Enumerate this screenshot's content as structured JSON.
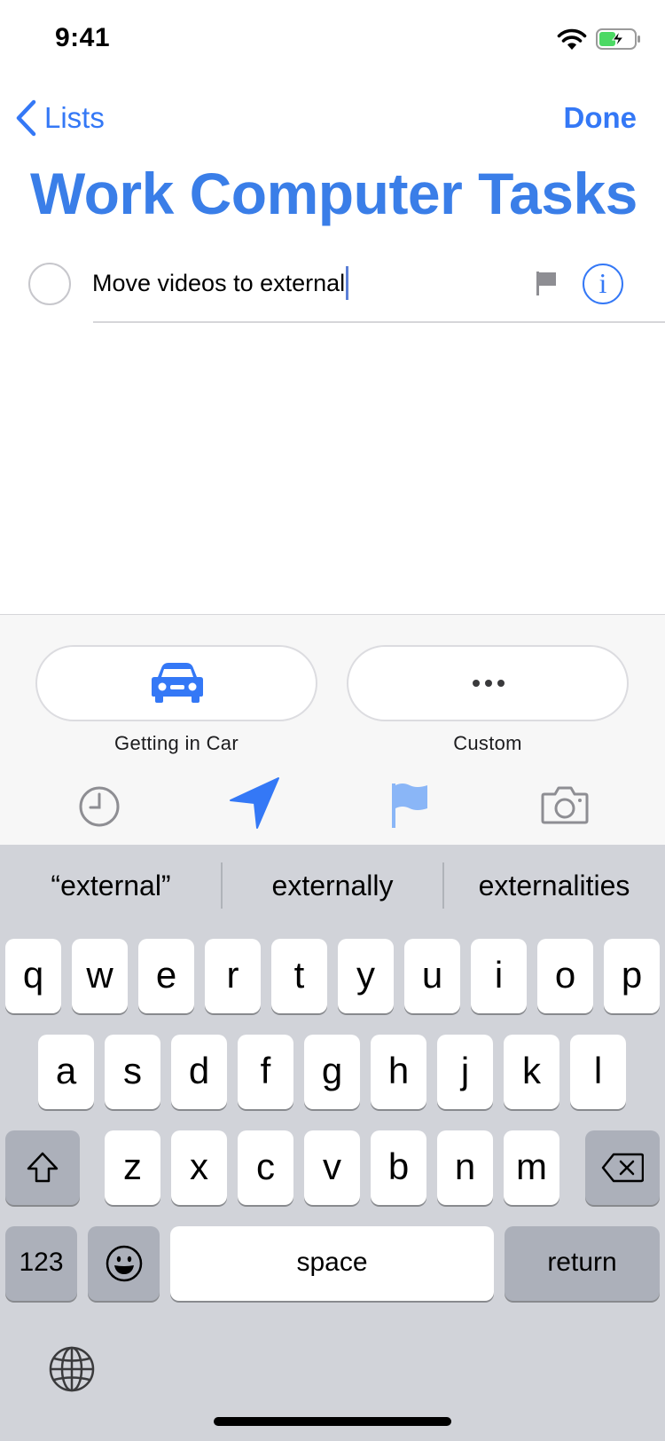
{
  "status_bar": {
    "time": "9:41"
  },
  "nav": {
    "back_label": "Lists",
    "done_label": "Done"
  },
  "list_title": "Work Computer Tasks",
  "reminder": {
    "text": "Move videos to external"
  },
  "quick_suggestions": [
    {
      "label": "Getting in Car",
      "icon": "car-icon"
    },
    {
      "label": "Custom",
      "icon": "more-icon"
    }
  ],
  "toolbar_icons": [
    "clock-icon",
    "location-arrow-icon",
    "flag-icon",
    "camera-icon"
  ],
  "predictions": [
    "“external”",
    "externally",
    "externalities"
  ],
  "keyboard": {
    "row1": [
      "q",
      "w",
      "e",
      "r",
      "t",
      "y",
      "u",
      "i",
      "o",
      "p"
    ],
    "row2": [
      "a",
      "s",
      "d",
      "f",
      "g",
      "h",
      "j",
      "k",
      "l"
    ],
    "row3": [
      "z",
      "x",
      "c",
      "v",
      "b",
      "n",
      "m"
    ],
    "numbers_label": "123",
    "space_label": "space",
    "return_label": "return"
  },
  "colors": {
    "accent": "#3478f6",
    "title": "#3a7ee8",
    "keyboard_bg": "#d1d3d9",
    "dark_key": "#acb0ba"
  }
}
